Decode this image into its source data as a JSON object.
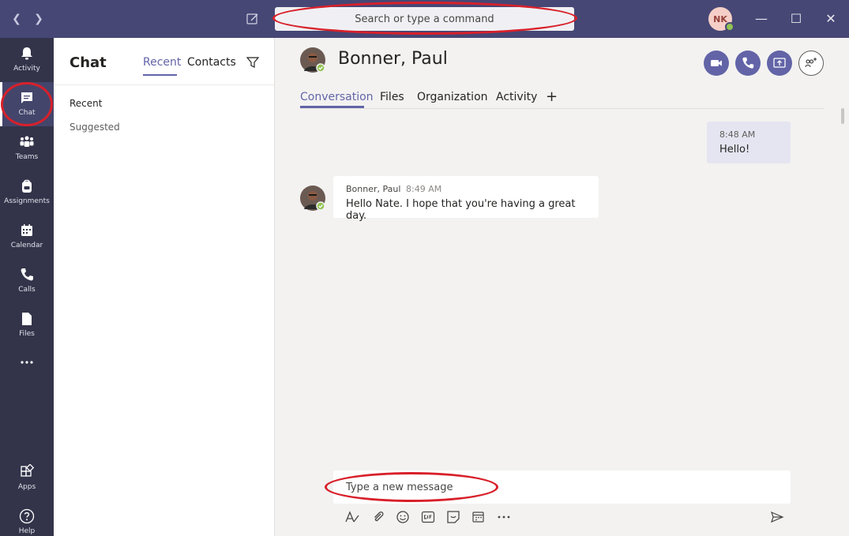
{
  "titlebar": {
    "search_placeholder": "Search or type a command",
    "user_initials": "NK"
  },
  "appbar": {
    "items": [
      {
        "label": "Activity",
        "icon": "bell-icon"
      },
      {
        "label": "Chat",
        "icon": "chat-icon"
      },
      {
        "label": "Teams",
        "icon": "teams-icon"
      },
      {
        "label": "Assignments",
        "icon": "backpack-icon"
      },
      {
        "label": "Calendar",
        "icon": "calendar-icon"
      },
      {
        "label": "Calls",
        "icon": "phone-icon"
      },
      {
        "label": "Files",
        "icon": "file-icon"
      }
    ],
    "bottom_items": [
      {
        "label": "Apps",
        "icon": "apps-icon"
      },
      {
        "label": "Help",
        "icon": "help-icon"
      }
    ]
  },
  "list": {
    "title": "Chat",
    "tabs": [
      "Recent",
      "Contacts"
    ],
    "sections": [
      "Recent",
      "Suggested"
    ]
  },
  "main": {
    "contact_name": "Bonner, Paul",
    "tabs": [
      "Conversation",
      "Files",
      "Organization",
      "Activity"
    ],
    "messages": [
      {
        "author": "",
        "time": "8:48 AM",
        "text": "Hello!"
      },
      {
        "author": "Bonner, Paul",
        "time": "8:49 AM",
        "text": "Hello Nate. I hope that you're having a great day."
      }
    ],
    "compose_placeholder": "Type a new message"
  },
  "colors": {
    "accent": "#6264a7",
    "titlebar": "#464775",
    "appbar": "#33344a",
    "presence_available": "#92c353",
    "annotation_red": "#d8202a"
  }
}
